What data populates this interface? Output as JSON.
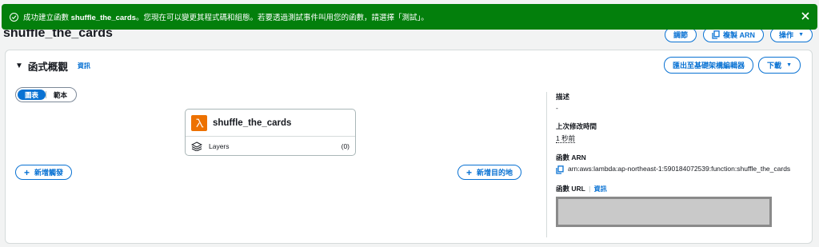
{
  "flash": {
    "prefix": "成功建立函數 ",
    "function_name": "shuffle_the_cards",
    "suffix": "。您現在可以變更其程式碼和組態。若要透過測試事件叫用您的函數，請選擇「測試」。",
    "status_icon": "check-circle-icon",
    "close_icon": "close-icon"
  },
  "header": {
    "title": "shuffle_the_cards",
    "throttle_label": "調節",
    "copy_arn_label": "複製 ARN",
    "actions_label": "操作"
  },
  "overview": {
    "title": "函式概觀",
    "info_label": "資訊",
    "export_label": "匯出至基礎架構編輯器",
    "download_label": "下載",
    "tabs": [
      {
        "label": "圖表",
        "active": true
      },
      {
        "label": "範本",
        "active": false
      }
    ],
    "function_node": {
      "name": "shuffle_the_cards",
      "layers_label": "Layers",
      "layers_count": "(0)"
    },
    "add_trigger_label": "新增觸發",
    "add_destination_label": "新增目的地"
  },
  "details": {
    "description_label": "描述",
    "description_value": "-",
    "last_modified_label": "上次修改時間",
    "last_modified_value": "1 秒前",
    "arn_label": "函數 ARN",
    "arn_value": "arn:aws:lambda:ap-northeast-1:590184072539:function:shuffle_the_cards",
    "url_label": "函數 URL",
    "url_info_label": "資訊"
  },
  "colors": {
    "success": "#037f0c",
    "primary": "#0972d3",
    "lambda": "#ed7100"
  }
}
